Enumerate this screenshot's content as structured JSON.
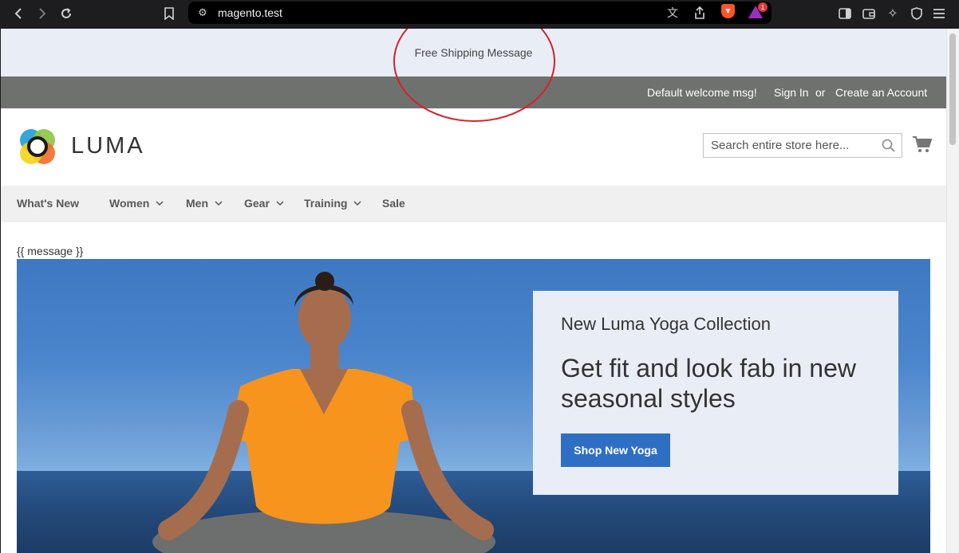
{
  "browser": {
    "url": "magento.test",
    "notification_count": "1"
  },
  "promo_bar": {
    "message": "Free Shipping Message"
  },
  "panel": {
    "welcome": "Default welcome msg!",
    "sign_in": "Sign In",
    "or": "or",
    "create_account": "Create an Account"
  },
  "header": {
    "logo_text": "LUMA",
    "search_placeholder": "Search entire store here..."
  },
  "nav": {
    "items": [
      {
        "label": "What's New",
        "has_dropdown": false
      },
      {
        "label": "Women",
        "has_dropdown": true
      },
      {
        "label": "Men",
        "has_dropdown": true
      },
      {
        "label": "Gear",
        "has_dropdown": true
      },
      {
        "label": "Training",
        "has_dropdown": true
      },
      {
        "label": "Sale",
        "has_dropdown": false
      }
    ]
  },
  "content": {
    "message_placeholder": "{{ message }}"
  },
  "hero": {
    "kicker": "New Luma Yoga Collection",
    "headline": "Get fit and look fab in new seasonal styles",
    "cta_label": "Shop New Yoga"
  },
  "colors": {
    "annotation": "#d81f2a",
    "panel_bg": "#6e716e",
    "promo_bg": "#e9eef6",
    "cta_bg": "#2f6fc3"
  },
  "icons": [
    "back-icon",
    "forward-icon",
    "reload-icon",
    "bookmark-icon",
    "site-settings-icon",
    "translate-icon",
    "share-icon",
    "brave-shields-icon",
    "brave-rewards-icon",
    "sidebar-icon",
    "wallet-icon",
    "leo-icon",
    "vpn-icon",
    "menu-icon",
    "search-icon",
    "cart-icon",
    "chevron-down-icon"
  ]
}
